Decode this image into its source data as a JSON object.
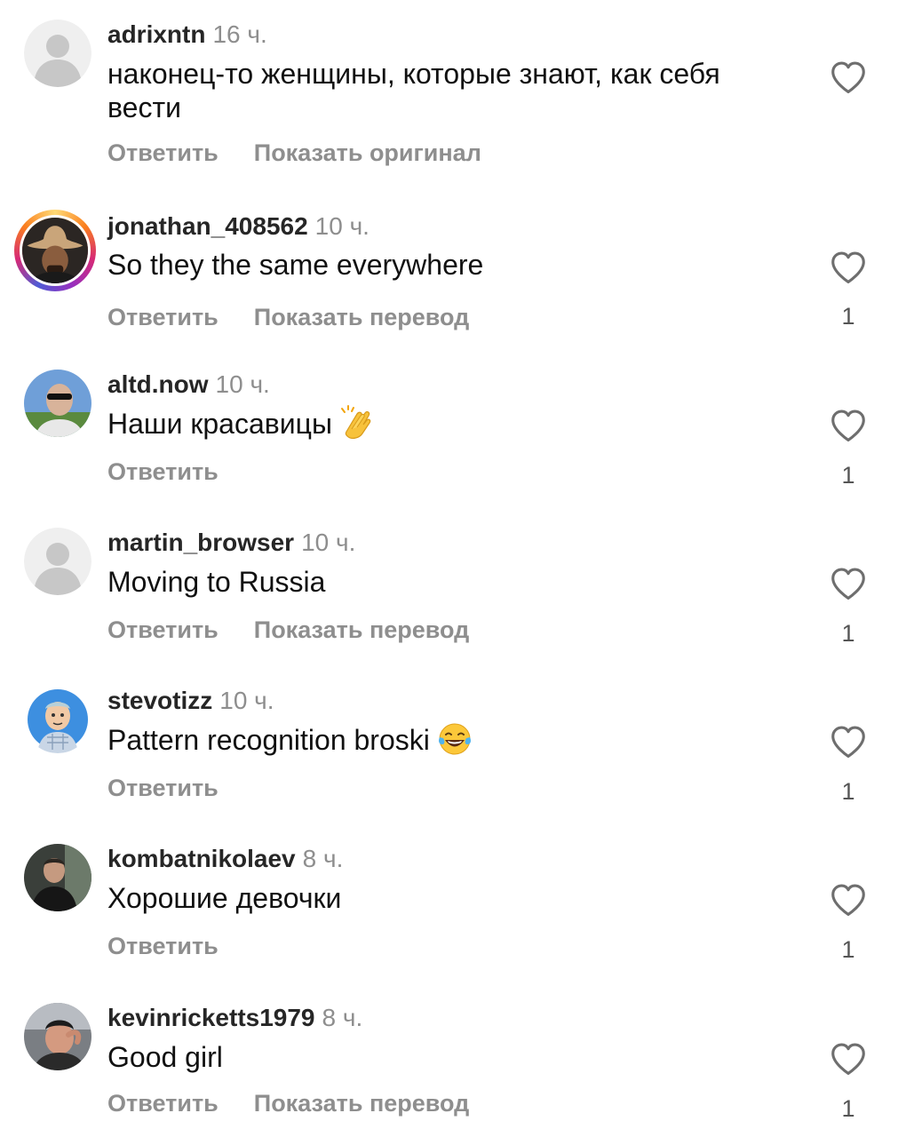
{
  "labels": {
    "reply": "Ответить"
  },
  "comments": [
    {
      "username": "adrixntn",
      "time": "16 ч.",
      "text": "наконец-то женщины, которые знают, как себя вести",
      "secondary_action": "Показать оригинал",
      "likes": ""
    },
    {
      "username": "jonathan_408562",
      "time": "10 ч.",
      "text": "So they the same everywhere",
      "secondary_action": "Показать перевод",
      "likes": "1"
    },
    {
      "username": "altd.now",
      "time": "10 ч.",
      "text": "Наши красавицы",
      "emoji": "clapping-hands-emoji",
      "secondary_action": "",
      "likes": "1"
    },
    {
      "username": "martin_browser",
      "time": "10 ч.",
      "text": "Moving to Russia",
      "secondary_action": "Показать перевод",
      "likes": "1"
    },
    {
      "username": "stevotizz",
      "time": "10 ч.",
      "text": "Pattern recognition broski",
      "emoji": "tears-of-joy-emoji",
      "secondary_action": "",
      "likes": "1"
    },
    {
      "username": "kombatnikolaev",
      "time": "8 ч.",
      "text": "Хорошие девочки",
      "secondary_action": "",
      "likes": "1"
    },
    {
      "username": "kevinricketts1979",
      "time": "8 ч.",
      "text": "Good girl",
      "secondary_action": "Показать перевод",
      "likes": "1"
    }
  ],
  "icons": {
    "like": "heart-outline-icon",
    "default_avatar": "default-avatar-icon"
  },
  "colors": {
    "secondary_text": "#8e8e8e",
    "story_ring": "#d62976"
  }
}
